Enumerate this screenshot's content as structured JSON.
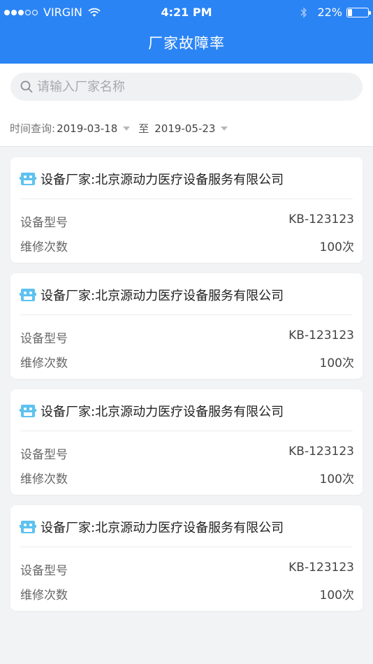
{
  "status_bar": {
    "carrier": "VIRGIN",
    "time": "4:21 PM",
    "battery_pct": "22%",
    "battery_level": 0.22,
    "signal_filled": 3,
    "signal_total": 5
  },
  "nav": {
    "title": "厂家故障率"
  },
  "search": {
    "placeholder": "请输入厂家名称"
  },
  "date_filter": {
    "label": "时间查询:",
    "start": "2019-03-18",
    "separator": "至",
    "end": "2019-05-23"
  },
  "colors": {
    "primary": "#2b84f4",
    "icon": "#5ec2f0"
  },
  "cards": [
    {
      "vendor_label": "设备厂家:",
      "vendor": "北京源动力医疗设备服务有限公司",
      "model_label": "设备型号",
      "model": "KB-123123",
      "repair_label": "维修次数",
      "repair": "100次"
    },
    {
      "vendor_label": "设备厂家:",
      "vendor": "北京源动力医疗设备服务有限公司",
      "model_label": "设备型号",
      "model": "KB-123123",
      "repair_label": "维修次数",
      "repair": "100次"
    },
    {
      "vendor_label": "设备厂家:",
      "vendor": "北京源动力医疗设备服务有限公司",
      "model_label": "设备型号",
      "model": "KB-123123",
      "repair_label": "维修次数",
      "repair": "100次"
    },
    {
      "vendor_label": "设备厂家:",
      "vendor": "北京源动力医疗设备服务有限公司",
      "model_label": "设备型号",
      "model": "KB-123123",
      "repair_label": "维修次数",
      "repair": "100次"
    }
  ]
}
